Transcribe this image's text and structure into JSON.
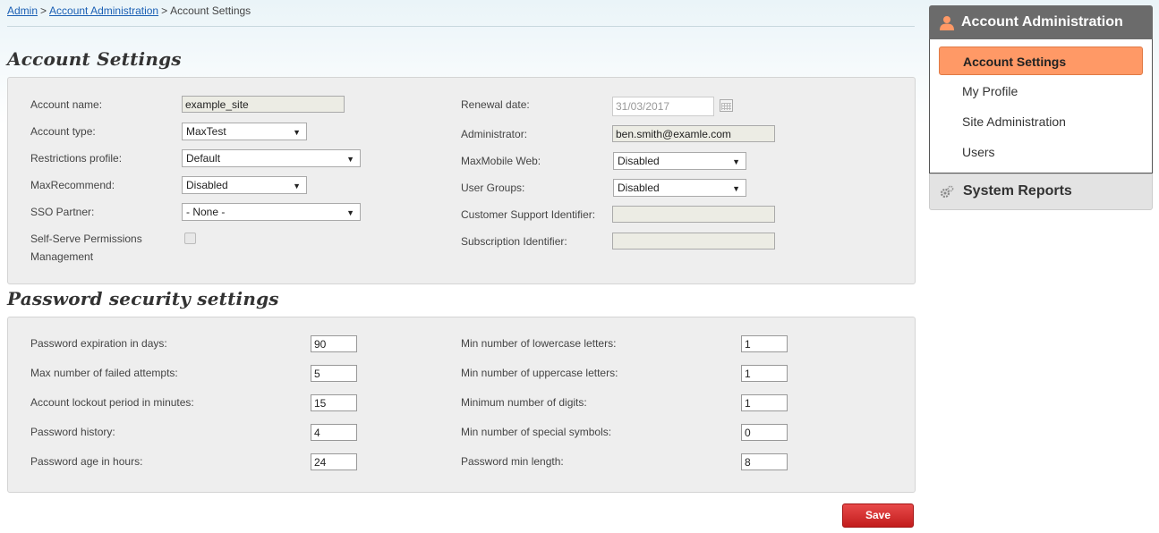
{
  "breadcrumb": {
    "items": [
      "Admin",
      "Account Administration"
    ],
    "current": "Account Settings",
    "separator": ">"
  },
  "account_settings": {
    "title": "Account Settings",
    "account_name_label": "Account name:",
    "account_name_value": "example_site",
    "account_type_label": "Account type:",
    "account_type_value": "MaxTest",
    "restrictions_label": "Restrictions profile:",
    "restrictions_value": "Default",
    "maxrecommend_label": "MaxRecommend:",
    "maxrecommend_value": "Disabled",
    "sso_label": "SSO Partner:",
    "sso_value": "- None -",
    "selfserve_label_1": "Self-Serve Permissions",
    "selfserve_label_2": "Management",
    "renewal_label": "Renewal date:",
    "renewal_value": "31/03/2017",
    "administrator_label": "Administrator:",
    "administrator_value": "ben.smith@examle.com",
    "maxmobile_label": "MaxMobile Web:",
    "maxmobile_value": "Disabled",
    "user_groups_label": "User Groups:",
    "user_groups_value": "Disabled",
    "csi_label": "Customer Support Identifier:",
    "csi_value": "",
    "subscription_label": "Subscription Identifier:",
    "subscription_value": ""
  },
  "password_settings": {
    "title": "Password security settings",
    "expiration_label": "Password expiration in days:",
    "expiration_value": "90",
    "failed_label": "Max number of failed attempts:",
    "failed_value": "5",
    "lockout_label": "Account lockout period in minutes:",
    "lockout_value": "15",
    "history_label": "Password history:",
    "history_value": "4",
    "age_label": "Password age in hours:",
    "age_value": "24",
    "lower_label": "Min number of lowercase letters:",
    "lower_value": "1",
    "upper_label": "Min number of uppercase letters:",
    "upper_value": "1",
    "digits_label": "Minimum number of digits:",
    "digits_value": "1",
    "special_label": "Min number of special symbols:",
    "special_value": "0",
    "minlength_label": "Password min length:",
    "minlength_value": "8"
  },
  "actions": {
    "save_label": "Save"
  },
  "sidebar": {
    "header": "Account Administration",
    "items": [
      "Account Settings",
      "My Profile",
      "Site Administration",
      "Users"
    ],
    "active_index": 0,
    "footer": "System Reports"
  },
  "colors": {
    "accent": "#ff9966",
    "save": "#d32f2f",
    "link": "#1a5fb4",
    "sidebar_header": "#6b6b6b"
  }
}
